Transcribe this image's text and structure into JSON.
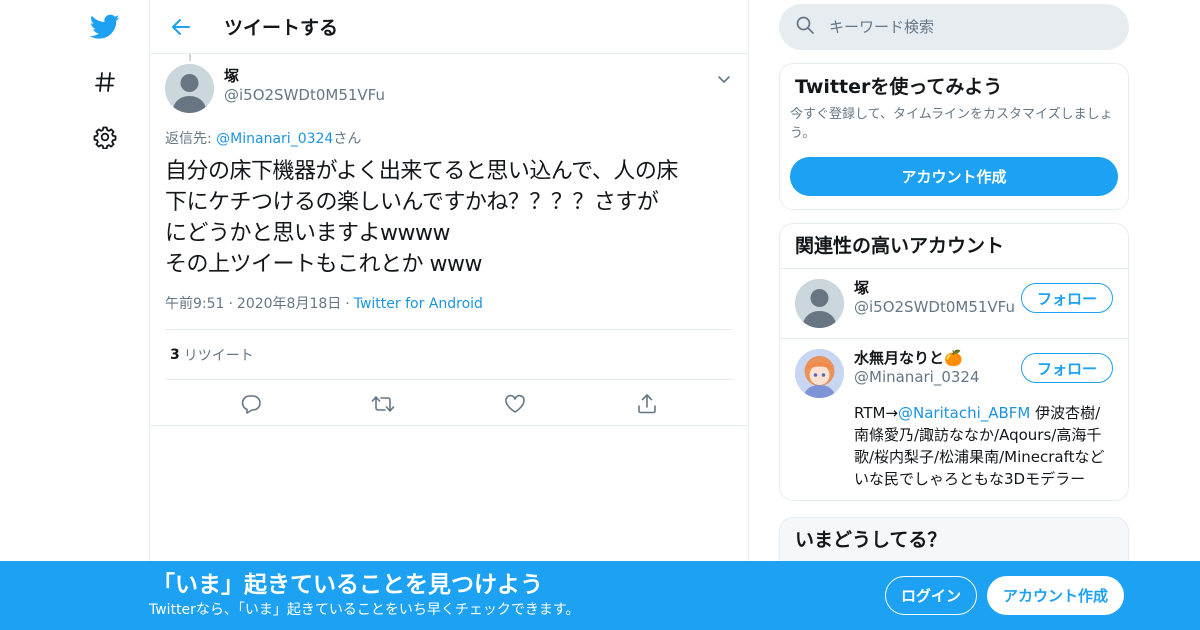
{
  "colors": {
    "accent": "#1da1f2",
    "link": "#1b95e0",
    "text": "#14171a",
    "muted": "#657786",
    "border": "#e6ecf0"
  },
  "nav": {
    "logo_icon": "twitter-bird-icon",
    "explore_icon": "hashtag-icon",
    "settings_icon": "gear-icon"
  },
  "header": {
    "back_icon": "arrow-left-icon",
    "title": "ツイートする"
  },
  "tweet": {
    "author_name": "塚",
    "author_handle": "@i5O2SWDt0M51VFu",
    "reply_prefix": "返信先: ",
    "reply_handle": "@Minanari_0324",
    "reply_suffix": "さん",
    "text": "自分の床下機器がよく出来てると思い込んで、人の床\n下にケチつけるの楽しいんですかね？？？？さすが\nにどうかと思いますよwwww\nその上ツイートもこれとか www",
    "time": "午前9:51",
    "date": "2020年8月18日",
    "source": "Twitter for Android",
    "retweet_count": "3",
    "retweet_label": "リツイート",
    "actions": [
      "reply-icon",
      "retweet-icon",
      "like-icon",
      "share-icon"
    ]
  },
  "search": {
    "placeholder": "キーワード検索",
    "icon": "search-icon"
  },
  "signup_card": {
    "title": "Twitterを使ってみよう",
    "desc": "今すぐ登録して、タイムラインをカスタマイズしましょう。",
    "button": "アカウント作成"
  },
  "related": {
    "title": "関連性の高いアカウント",
    "accounts": [
      {
        "name": "塚",
        "handle": "@i5O2SWDt0M51VFu",
        "follow": "フォロー"
      },
      {
        "name": "水無月なりと🍊",
        "handle": "@Minanari_0324",
        "follow": "フォロー",
        "bio_prefix": "RTM→",
        "bio_link": "@Naritachi_ABFM",
        "bio_rest": " 伊波杏樹/南條愛乃/諏訪ななか/Aqours/高海千歌/桜内梨子/松浦果南/Minecraftなど いな民でしゃろともな3Dモデラー"
      }
    ]
  },
  "trends": {
    "title": "いまどうしてる？"
  },
  "banner": {
    "title": "「いま」起きていることを見つけよう",
    "subtitle": "Twitterなら、「いま」起きていることをいち早くチェックできます。",
    "login": "ログイン",
    "signup": "アカウント作成"
  }
}
